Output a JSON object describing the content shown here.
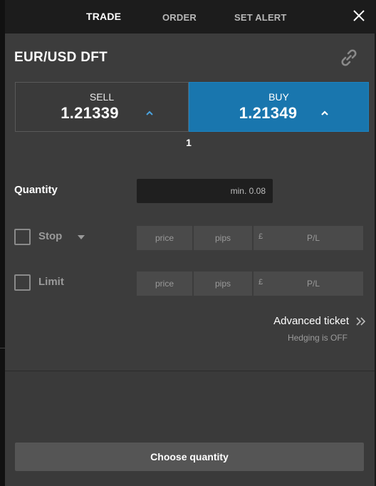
{
  "tabs": [
    {
      "label": "TRADE",
      "active": true
    },
    {
      "label": "ORDER",
      "active": false
    },
    {
      "label": "SET ALERT",
      "active": false
    }
  ],
  "icons": {
    "close": "close-icon",
    "link": "link-icon",
    "sell_arrow": "chevron-up-icon",
    "buy_arrow": "chevron-up-icon",
    "advanced": "double-chevron-right-icon",
    "stop_dropdown": "caret-down-icon"
  },
  "instrument": {
    "name": "EUR/USD DFT"
  },
  "sell": {
    "label": "SELL",
    "price": "1.21339"
  },
  "buy": {
    "label": "BUY",
    "price": "1.21349"
  },
  "spread": "1",
  "quantity": {
    "label": "Quantity",
    "placeholder": "min. 0.08",
    "value": ""
  },
  "stop": {
    "label": "Stop",
    "checked": false,
    "price_placeholder": "price",
    "pips_placeholder": "pips",
    "currency": "£",
    "pl_placeholder": "P/L"
  },
  "limit": {
    "label": "Limit",
    "checked": false,
    "price_placeholder": "price",
    "pips_placeholder": "pips",
    "currency": "£",
    "pl_placeholder": "P/L"
  },
  "advanced_ticket": {
    "label": "Advanced ticket"
  },
  "hedging": "Hedging is OFF",
  "submit": {
    "label": "Choose quantity"
  },
  "colors": {
    "buy": "#1976ae",
    "panel": "#3c3c3c",
    "header": "#1c1c1c"
  }
}
